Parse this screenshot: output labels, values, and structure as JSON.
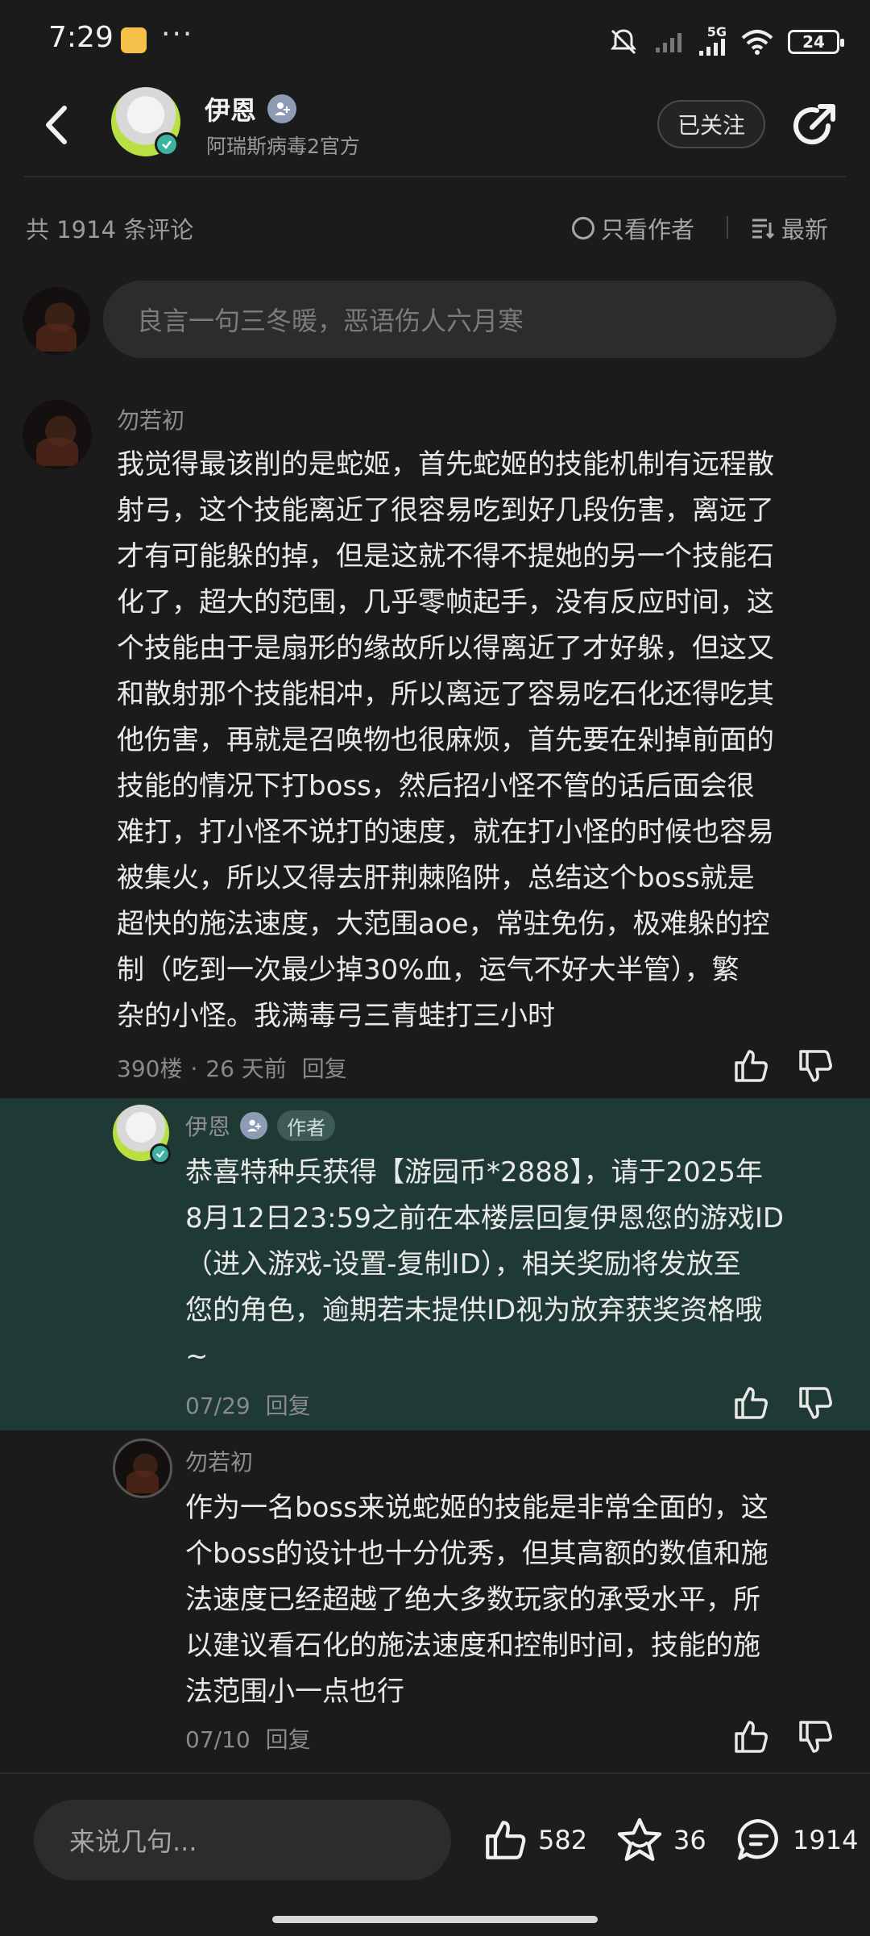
{
  "status_bar": {
    "time": "7:29",
    "dots": "···",
    "network": "5G",
    "battery": "24"
  },
  "header": {
    "name": "伊恩",
    "subtitle": "阿瑞斯病毒2官方",
    "follow_label": "已关注"
  },
  "filter": {
    "count_label": "共 1914 条评论",
    "only_author_label": "只看作者",
    "sort_label": "最新"
  },
  "comment_input": {
    "placeholder": "良言一句三冬暖，恶语伤人六月寒"
  },
  "comments": [
    {
      "nick": "勿若初",
      "lines": [
        "我觉得最该削的是蛇姬，首先蛇姬的技能机制有远程散",
        "射弓，这个技能离近了很容易吃到好几段伤害，离远了",
        "才有可能躲的掉，但是这就不得不提她的另一个技能石",
        "化了，超大的范围，几乎零帧起手，没有反应时间，这",
        "个技能由于是扇形的缘故所以得离近了才好躲，但这又",
        "和散射那个技能相冲，所以离远了容易吃石化还得吃其",
        "他伤害，再就是召唤物也很麻烦，首先要在剁掉前面的",
        "技能的情况下打boss，然后招小怪不管的话后面会很",
        "难打，打小怪不说打的速度，就在打小怪的时候也容易",
        "被集火，所以又得去肝荆棘陷阱，总结这个boss就是",
        "超快的施法速度，大范围aoe，常驻免伤，极难躲的控",
        "制（吃到一次最少掉30%血，运气不好大半管），繁",
        "杂的小怪。我满毒弓三青蛙打三小时"
      ],
      "floor": "390楼",
      "time": "26 天前",
      "reply": "回复"
    }
  ],
  "replies": [
    {
      "nick": "伊恩",
      "author_tag": "作者",
      "lines": [
        "恭喜特种兵获得【游园币*2888】，请于2025年",
        "8月12日23:59之前在本楼层回复伊恩您的游戏ID",
        "（进入游戏-设置-复制ID），相关奖励将发放至",
        "您的角色，逾期若未提供ID视为放弃获奖资格哦",
        "~"
      ],
      "time": "07/29",
      "reply": "回复"
    },
    {
      "nick": "勿若初",
      "lines": [
        "作为一名boss来说蛇姬的技能是非常全面的，这",
        "个boss的设计也十分优秀，但其高额的数值和施",
        "法速度已经超越了绝大多数玩家的承受水平，所",
        "以建议看石化的施法速度和控制时间，技能的施",
        "法范围小一点也行"
      ],
      "time": "07/10",
      "reply": "回复"
    }
  ],
  "bottom_bar": {
    "input_placeholder": "来说几句...",
    "likes": "582",
    "favorites": "36",
    "comments": "1914"
  },
  "colors": {
    "background": "#1b1b1b",
    "author_reply_bg": "#1f3a35",
    "verify_badge": "#3bb3a0"
  }
}
